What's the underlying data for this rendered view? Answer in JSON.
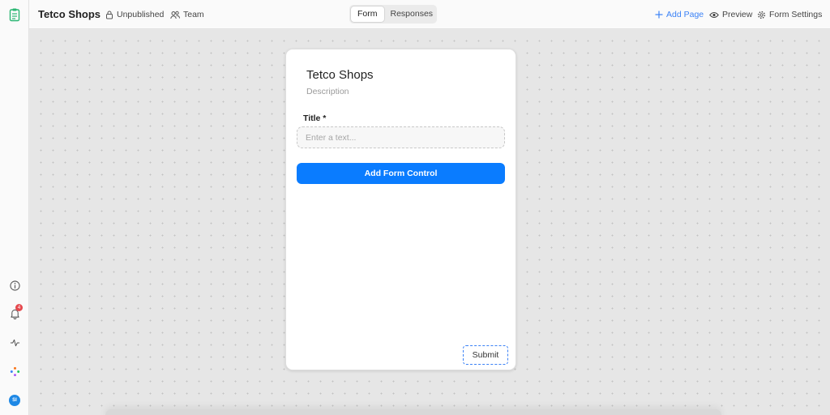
{
  "header": {
    "title": "Tetco Shops",
    "status": "Unpublished",
    "team": "Team",
    "tabs": [
      {
        "label": "Form",
        "active": true
      },
      {
        "label": "Responses",
        "active": false
      }
    ],
    "actions": {
      "add_page": "Add Page",
      "preview": "Preview",
      "form_settings": "Form Settings"
    }
  },
  "sidebar": {
    "notification_count": "4",
    "avatar_initials": "SI",
    "icons": [
      "form-icon",
      "info-icon",
      "bell-icon",
      "activity-icon",
      "sparkle-icon",
      "avatar"
    ]
  },
  "form": {
    "title": "Tetco Shops",
    "description": "Description",
    "field_label": "Title *",
    "field_placeholder": "Enter a text...",
    "add_control_label": "Add Form Control",
    "submit_label": "Submit"
  },
  "colors": {
    "accent": "#0a7cff",
    "link": "#3b82f6",
    "badge": "#e5484d",
    "avatar": "#1e88e5",
    "logo": "#2bb673"
  }
}
